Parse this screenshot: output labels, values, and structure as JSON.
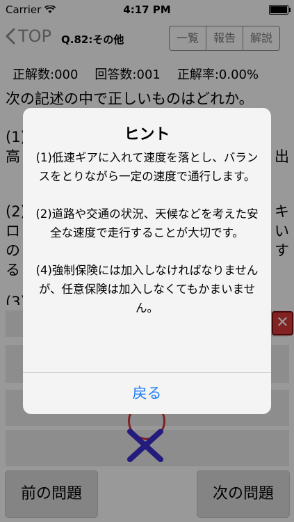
{
  "status_bar": {
    "carrier": "Carrier",
    "time": "4:17 PM"
  },
  "nav": {
    "back_label": "TOP",
    "question_title": "Q.82:その他",
    "segments": [
      "一覧",
      "報告",
      "解説"
    ]
  },
  "stats": {
    "correct": "正解数:000",
    "answered": "回答数:001",
    "rate": "正解率:0.00%"
  },
  "question_text": "次の記述の中で正しいものはどれか。",
  "choices_underlay": {
    "c1_start": "(1).",
    "c1_line2": "高",
    "c1_tail": "出",
    "c2_start": "(2).",
    "c2_line2": "ロ",
    "c2_line3": "の",
    "c2_line4": "る",
    "c2_tail1": "キ",
    "c2_tail2": "い",
    "c2_tail3": "す",
    "c3_start": "(3)"
  },
  "buttons": {
    "prev": "前の問題",
    "next": "次の問題"
  },
  "alert": {
    "title": "ヒント",
    "body": "(1)低速ギアに入れて速度を落とし、バランスをとりながら一定の速度で通行します。\n\n(2)道路や交通の状況、天候などを考えた安全な速度で走行することが大切です。\n\n(4)強制保険には加入しなければなりませんが、任意保険は加入しなくてもかまいません。",
    "button": "戻る"
  },
  "colors": {
    "accent": "#1a7cf5",
    "wrong": "#d93a3a",
    "x_mark": "#3b2fd0"
  }
}
